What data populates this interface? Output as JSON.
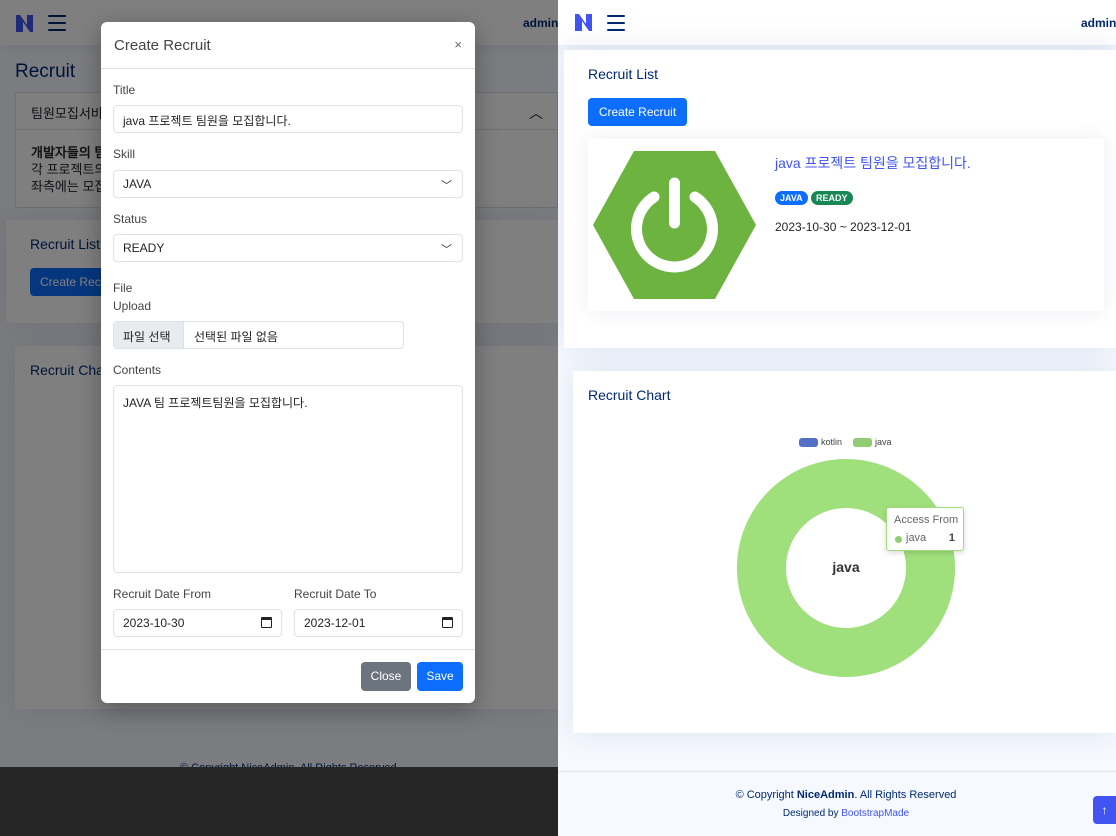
{
  "header": {
    "user": "admin"
  },
  "left_page": {
    "title": "Recruit",
    "accordion_label": "팀원모집서비",
    "accordion_body": [
      "개발자들의 팀",
      "각 프로젝트의",
      "좌측에는 모집"
    ],
    "recruit_list_title": "Recruit List",
    "create_button": "Create Recruit",
    "chart_title": "Recruit Chart",
    "footer_text": "© Copyright NiceAdmin. All Rights Reserved"
  },
  "modal": {
    "title": "Create Recruit",
    "close_icon": "×",
    "fields": {
      "title_label": "Title",
      "title_value": "java 프로젝트 팀원을 모집합니다.",
      "skill_label": "Skill",
      "skill_value": "JAVA",
      "status_label": "Status",
      "status_value": "READY",
      "file_label_1": "File",
      "file_label_2": "Upload",
      "file_button": "파일 선택",
      "file_status": "선택된 파일 없음",
      "contents_label": "Contents",
      "contents_value": "JAVA 팀 프로젝트팀원을 모집합니다.",
      "date_from_label": "Recruit Date From",
      "date_from_value": "2023-10-30",
      "date_to_label": "Recruit Date To",
      "date_to_value": "2023-12-01"
    },
    "buttons": {
      "close": "Close",
      "save": "Save"
    }
  },
  "right_page": {
    "recruit_list": {
      "title": "Recruit List",
      "create_button": "Create Recruit",
      "item": {
        "title": "java 프로젝트 팀원을 모집합니다.",
        "badges": [
          {
            "text": "JAVA",
            "color": "#0d6efd"
          },
          {
            "text": "READY",
            "color": "#198754"
          }
        ],
        "date_range": "2023-10-30 ~ 2023-12-01",
        "image_icon": "power-hexagon-icon"
      }
    },
    "chart": {
      "title": "Recruit Chart",
      "center_label": "java",
      "tooltip": {
        "title": "Access From",
        "name": "java",
        "value": "1"
      }
    },
    "footer": {
      "copyright_prefix": "© Copyright ",
      "brand": "NiceAdmin",
      "copyright_suffix": ". All Rights Reserved",
      "designed_by": "Designed by ",
      "designer": "BootstrapMade"
    }
  },
  "chart_data": {
    "type": "pie",
    "title": "Recruit Chart",
    "donut": true,
    "series": [
      {
        "name": "kotlin",
        "value": 0,
        "color": "#5470c6"
      },
      {
        "name": "java",
        "value": 1,
        "color": "#91cc75"
      }
    ],
    "legend": "top-center"
  }
}
